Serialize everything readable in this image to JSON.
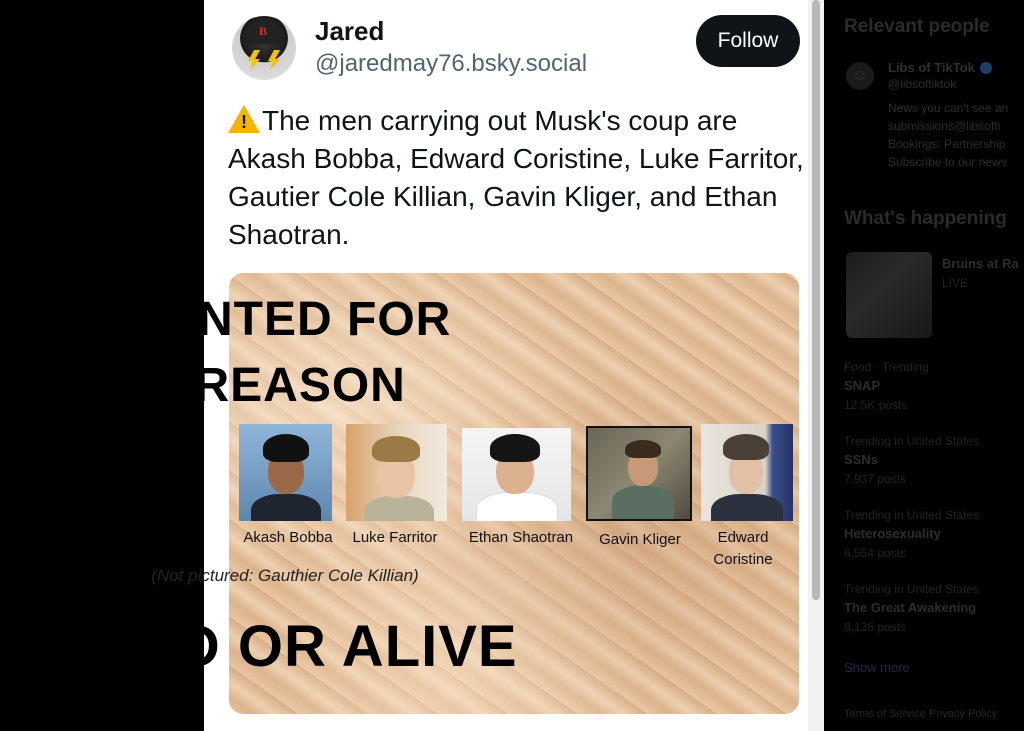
{
  "post": {
    "author_name": "Jared",
    "author_handle": "@jaredmay76.bsky.social",
    "follow_label": "Follow",
    "text": "The men carrying out Musk's coup are Akash Bobba, Edward Coristine, Luke Farritor, Gautier Cole Killian, Gavin Kliger, and Ethan Shaotran."
  },
  "poster": {
    "title_line1": "WANTED FOR",
    "title_line2": "TREASON",
    "captions": [
      "Akash Bobba",
      "Luke Farritor",
      "Ethan Shaotran",
      "Gavin Kliger",
      "Edward",
      "Coristine"
    ],
    "note": "(Not pictured: Gauthier Cole Killian)",
    "bottom": "DEAD OR ALIVE"
  },
  "right_panel": {
    "relevant_title": "Relevant people",
    "person_name": "Libs of TikTok",
    "person_handle": "@libsoftiktok",
    "person_bio": [
      "News you can't see an",
      "submissions@libsofti",
      "Bookings: Partnership",
      "Subscribe to our news"
    ],
    "happening_title": "What's happening",
    "trends": [
      {
        "name": "Bruins at Ra",
        "meta": "LIVE"
      },
      {
        "name": "SNAP",
        "meta": "Food · Trending"
      },
      {
        "name": "SSNs",
        "meta": "Trending in United States"
      },
      {
        "name": "Heterosexuality",
        "meta": "Trending in United States"
      },
      {
        "name": "The Great Awakening",
        "meta": "Trending in United States"
      }
    ],
    "trend_counts": [
      "12.5K posts",
      "7,937 posts",
      "6,554 posts",
      "8,135 posts"
    ],
    "show_more": "Show more",
    "footer": "Terms of Service   Privacy Policy"
  },
  "colors": {
    "text": "#0f1419",
    "handle": "#536471",
    "follow_bg": "#0f1419",
    "poster_paper": "#e2bd98",
    "warning": "#f5b400"
  }
}
